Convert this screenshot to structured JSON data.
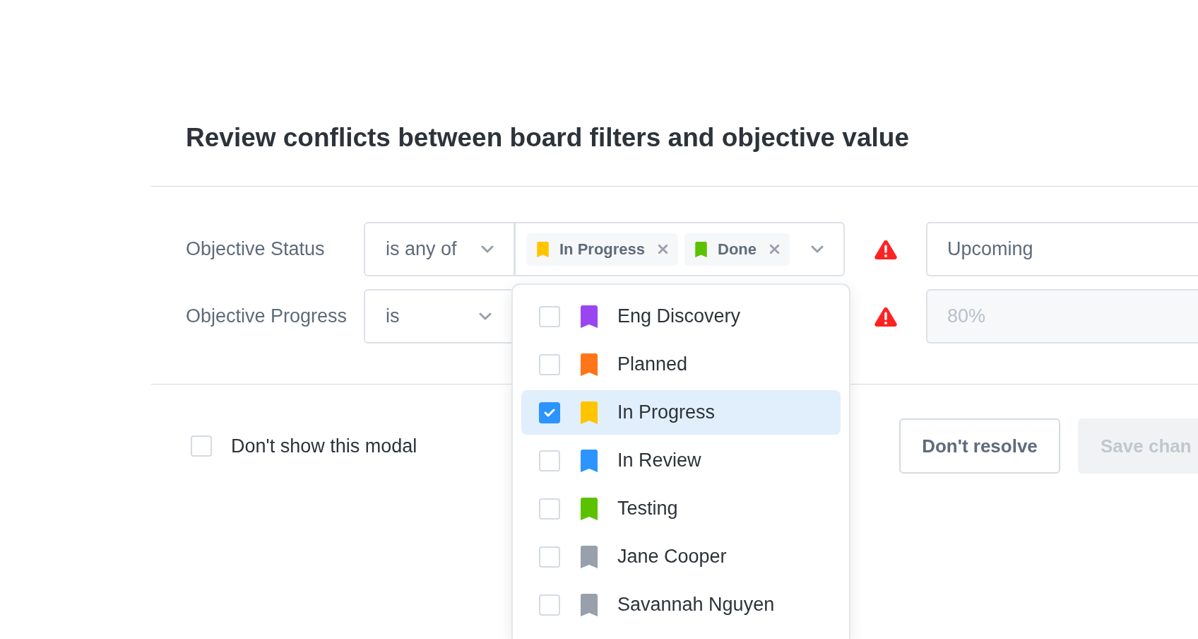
{
  "title": "Review conflicts between board filters and objective value",
  "filters": [
    {
      "label": "Objective Status",
      "operator": "is any of",
      "chips": [
        {
          "label": "In Progress",
          "color": "#ffc400"
        },
        {
          "label": "Done",
          "color": "#5cc200"
        }
      ],
      "warning": true,
      "value": "Upcoming",
      "disabled": false
    },
    {
      "label": "Objective Progress",
      "operator": "is",
      "warning": true,
      "value": "80%",
      "disabled": true
    }
  ],
  "dropdown": {
    "options": [
      {
        "label": "Eng Discovery",
        "color": "#9b45f2",
        "checked": false,
        "selected": false
      },
      {
        "label": "Planned",
        "color": "#ff7517",
        "checked": false,
        "selected": false
      },
      {
        "label": "In Progress",
        "color": "#ffc400",
        "checked": true,
        "selected": true
      },
      {
        "label": "In Review",
        "color": "#2b94ff",
        "checked": false,
        "selected": false
      },
      {
        "label": "Testing",
        "color": "#5cc200",
        "checked": false,
        "selected": false
      },
      {
        "label": "Jane Cooper",
        "color": "#97a0ab",
        "checked": false,
        "selected": false
      },
      {
        "label": "Savannah Nguyen",
        "color": "#97a0ab",
        "checked": false,
        "selected": false
      }
    ]
  },
  "dont_show": {
    "label": "Don't show this modal",
    "checked": false
  },
  "buttons": [
    {
      "label": "Don't resolve",
      "disabled": false
    },
    {
      "label": "Save chan",
      "disabled": true
    }
  ]
}
